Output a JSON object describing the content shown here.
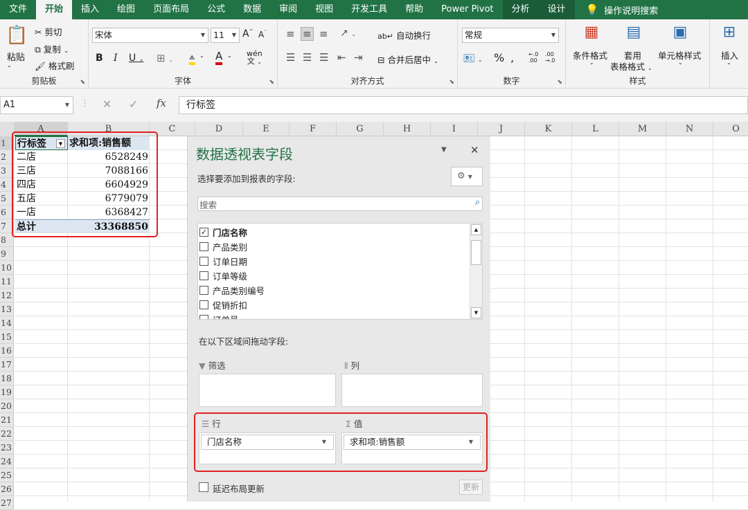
{
  "ribbon_tabs": [
    "文件",
    "开始",
    "插入",
    "绘图",
    "页面布局",
    "公式",
    "数据",
    "审阅",
    "视图",
    "开发工具",
    "帮助",
    "Power Pivot",
    "分析",
    "设计"
  ],
  "tell_me": "操作说明搜索",
  "clipboard": {
    "paste": "粘贴",
    "cut": "剪切",
    "copy": "复制",
    "format_painter": "格式刷",
    "group": "剪贴板"
  },
  "font": {
    "name": "宋体",
    "size": "11",
    "group": "字体"
  },
  "align": {
    "wrap": "自动换行",
    "merge": "合并后居中",
    "group": "对齐方式"
  },
  "number": {
    "format": "常规",
    "group": "数字"
  },
  "styles": {
    "conditional": "条件格式",
    "table_fmt1": "套用",
    "table_fmt2": "表格格式",
    "cell_style": "单元格样式",
    "group": "样式"
  },
  "cells": {
    "insert": "插入"
  },
  "name_box": "A1",
  "formula": "行标签",
  "columns": [
    "A",
    "B",
    "C",
    "D",
    "E",
    "F",
    "G",
    "H",
    "I",
    "J",
    "K",
    "L",
    "M",
    "N",
    "O"
  ],
  "rows": [
    "1",
    "2",
    "3",
    "4",
    "5",
    "6",
    "7",
    "8",
    "9",
    "10",
    "11",
    "12",
    "13",
    "14",
    "15",
    "16",
    "17",
    "18",
    "19",
    "20",
    "21",
    "22",
    "23",
    "24",
    "25",
    "26",
    "27"
  ],
  "pivot": {
    "header_row": "行标签",
    "header_value": "求和项:销售额",
    "rows": [
      {
        "label": "二店",
        "value": "6528249"
      },
      {
        "label": "三店",
        "value": "7088166"
      },
      {
        "label": "四店",
        "value": "6604929"
      },
      {
        "label": "五店",
        "value": "6779079"
      },
      {
        "label": "一店",
        "value": "6368427"
      }
    ],
    "total_label": "总计",
    "total_value": "33368850"
  },
  "panel": {
    "title": "数据透视表字段",
    "choose_label": "选择要添加到报表的字段:",
    "search_placeholder": "搜索",
    "fields": [
      {
        "name": "门店名称",
        "checked": true
      },
      {
        "name": "产品类别",
        "checked": false
      },
      {
        "name": "订单日期",
        "checked": false
      },
      {
        "name": "订单等级",
        "checked": false
      },
      {
        "name": "产品类别编号",
        "checked": false
      },
      {
        "name": "促销折扣",
        "checked": false
      },
      {
        "name": "订单号",
        "checked": false
      }
    ],
    "drag_label": "在以下区域间拖动字段:",
    "filter_label": "筛选",
    "columns_label": "列",
    "rows_label": "行",
    "values_label": "值",
    "rows_field": "门店名称",
    "values_field": "求和项:销售额",
    "defer_label": "延迟布局更新",
    "update_button": "更新"
  },
  "colors": {
    "accent": "#217346",
    "highlight": "#e02020",
    "pivot_header": "#dce6f1"
  }
}
